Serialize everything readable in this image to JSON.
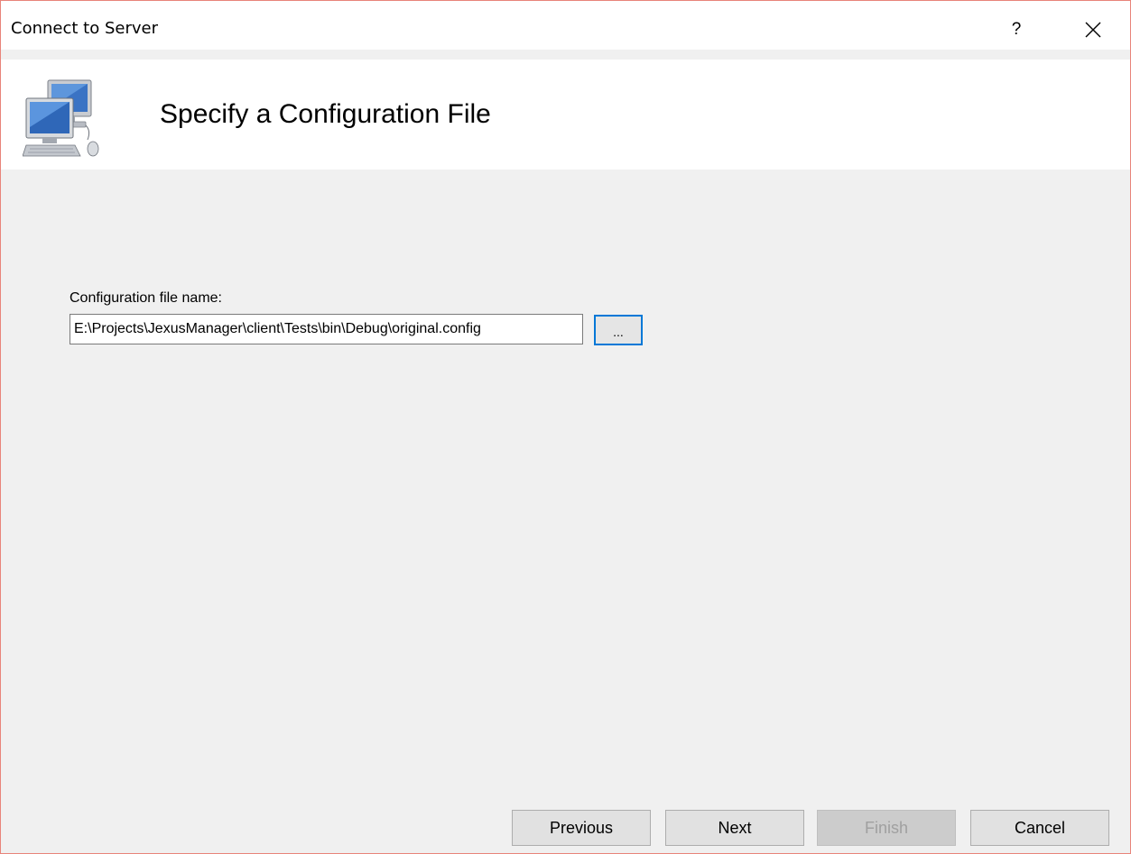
{
  "window": {
    "title": "Connect to Server",
    "help_label": "?",
    "close_icon": "close-icon"
  },
  "header": {
    "icon": "network-computers-icon",
    "title": "Specify a Configuration File"
  },
  "form": {
    "label": "Configuration file name:",
    "file_path": "E:\\Projects\\JexusManager\\client\\Tests\\bin\\Debug\\original.config",
    "browse_label": "..."
  },
  "footer": {
    "previous_label": "Previous",
    "next_label": "Next",
    "finish_label": "Finish",
    "finish_enabled": false,
    "cancel_label": "Cancel"
  },
  "colors": {
    "window_border": "#e8847a",
    "focus_accent": "#0078d7",
    "body_background": "#f0f0f0"
  }
}
